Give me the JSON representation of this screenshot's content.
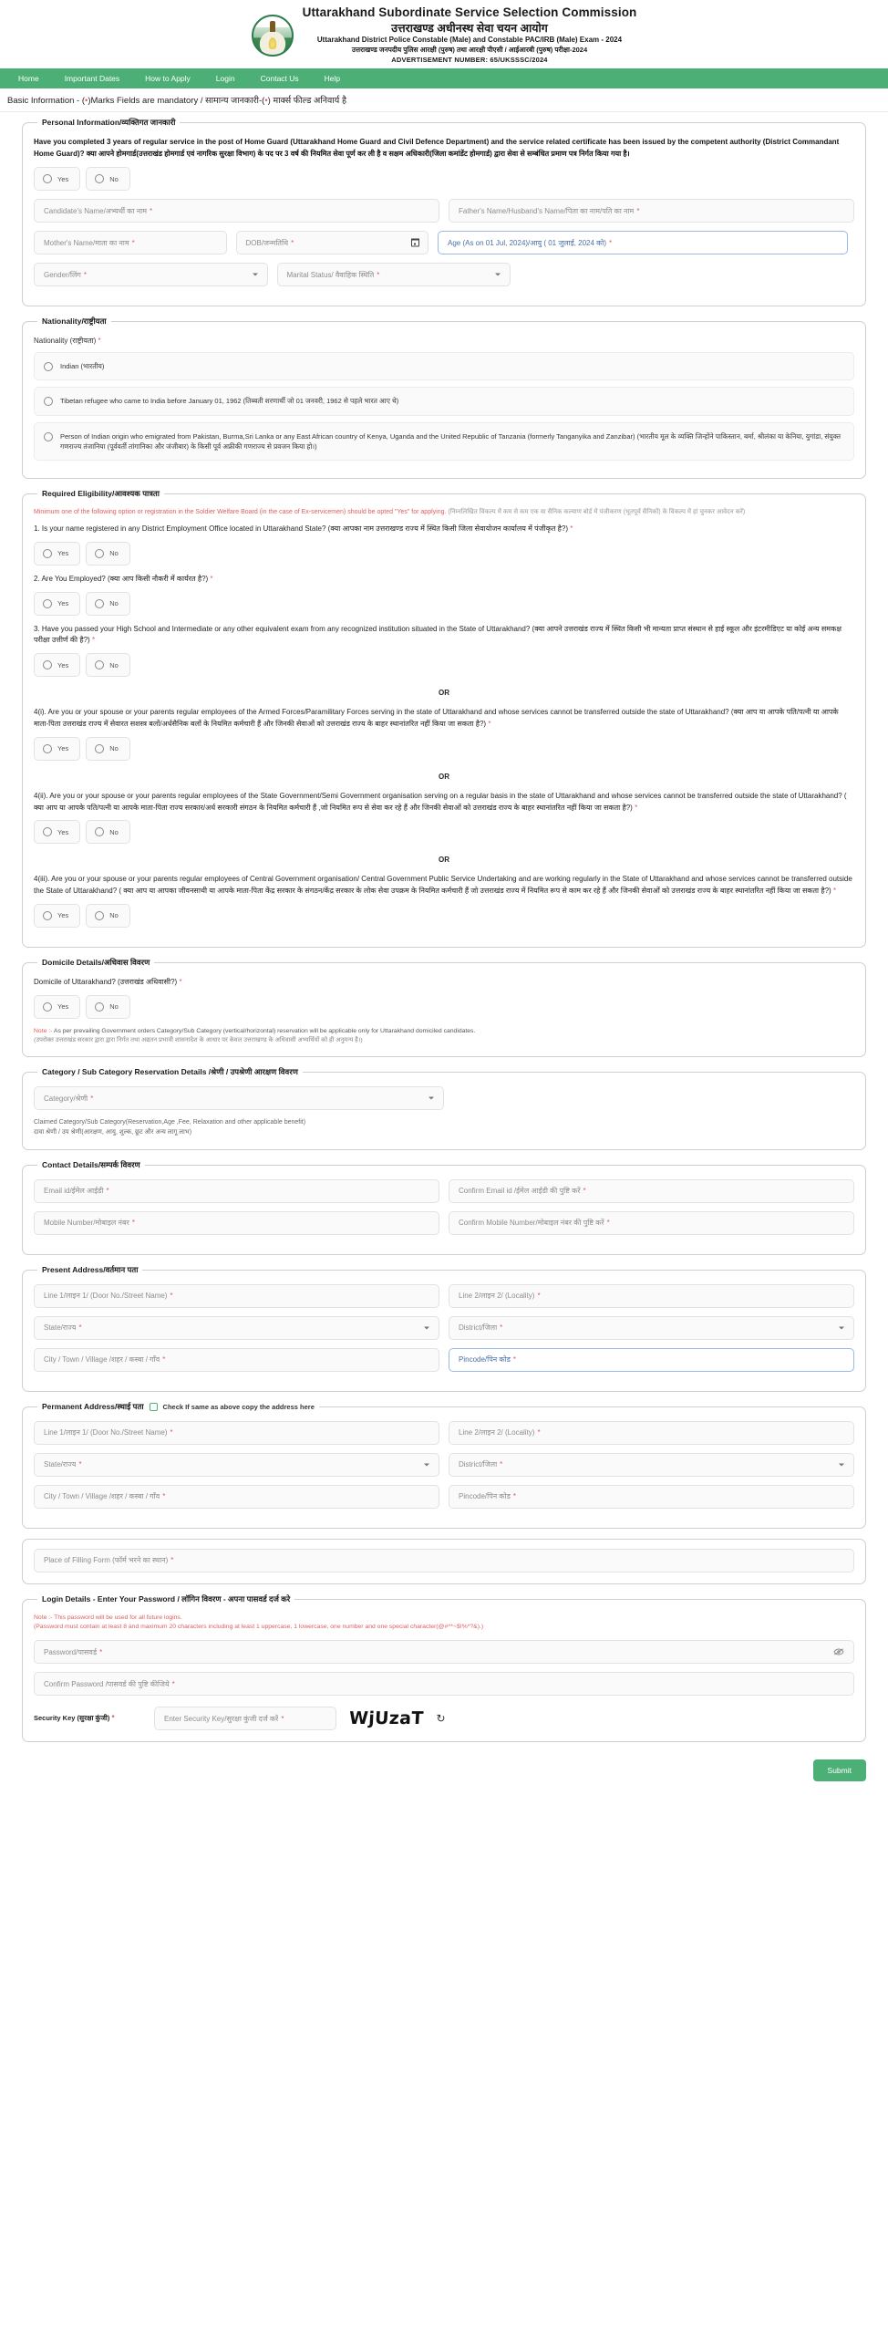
{
  "header": {
    "org_en": "Uttarakhand Subordinate Service Selection Commission",
    "org_hi": "उत्तराखण्ड अधीनस्थ सेवा चयन आयोग",
    "exam_en": "Uttarakhand District Police Constable (Male) and Constable PAC/IRB (Male) Exam - 2024",
    "exam_hi": "उत्तराखण्ड जनपदीय पुलिस आरक्षी (पुरुष) तथा आरक्षी पीएसी / आईआरबी (पुरुष) परीक्षा-2024",
    "advertisement": "ADVERTISEMENT NUMBER: 65/UKSSSC/2024",
    "emblem_alt": "uksssc-emblem"
  },
  "nav": {
    "items": [
      {
        "label": "Home"
      },
      {
        "label": "Important Dates"
      },
      {
        "label": "How to Apply"
      },
      {
        "label": "Login"
      },
      {
        "label": "Contact Us"
      },
      {
        "label": "Help"
      }
    ],
    "bg_color": "#4CAF76"
  },
  "page_title": {
    "prefix": "Basic Information - (",
    "star": "•",
    "middle": ")Marks Fields are mandatory / सामान्य जानकारी-(",
    "suffix": ") मार्क्स फील्ड अनिवार्य है"
  },
  "personal": {
    "legend": "Personal Information/व्यक्तिगत जानकारी",
    "question": "Have you completed 3 years of regular service in the post of Home Guard (Uttarakhand Home Guard and Civil Defence Department) and the service related certificate has been issued by the competent authority (District Commandant Home Guard)? क्या आपने होमगार्ड(उत्तराखंड होमगार्ड एवं नागरिक सुरक्षा विभाग) के पद पर 3 वर्ष की नियमित सेवा पूर्ण कर ली है व सक्षम अधिकारी(जिला कमांडेंट होमगार्ड) द्वारा सेवा से सम्बंधित प्रमाण पत्र निर्गत किया गया है।",
    "yes": "Yes",
    "no": "No",
    "candidate_name": "Candidate's Name/अभ्यर्थी का नाम",
    "father_name": "Father's Name/Husband's Name/पिता का नाम/पति का नाम",
    "mother_name": "Mother's Name/माता का नाम",
    "dob": "DOB/जन्मतिथि",
    "age": "Age (As on 01 Jul, 2024)/आयु ( 01 जुलाई, 2024 को)",
    "gender": "Gender/लिंग",
    "marital_status": "Marital Status/ वैवाहिक स्थिति"
  },
  "nationality": {
    "legend": "Nationality/राष्ट्रीयता",
    "field_label": "Nationality (राष्ट्रीयता)",
    "options": [
      "Indian (भारतीय)",
      "Tibetan refugee who came to India before January 01, 1962 (तिब्बती शरणार्थी जो 01 जनवरी, 1962 से पहले भारत आए थे)",
      "Person of Indian origin who emigrated from Pakistan, Burma,Sri Lanka or any East African country of Kenya, Uganda and the United Republic of Tanzania (formerly Tanganyika and Zanzibar) (भारतीय मूल के व्यक्ति जिन्होंने पाकिस्तान, बर्मा, श्रीलंका या केनिया, युगांडा, संयुक्त गणराज्य तंजानिया (पूर्ववर्ती तांगानिका और जंजीबार) के किसी पूर्व अफ्रीकी गणराज्य से प्रवजन किया हो।)"
    ]
  },
  "eligibility": {
    "legend": "Required Eligibility/आवश्यक पात्रता",
    "note": "Minimum one of the following option or registration in the Soldier Welfare Board (in the case of Ex-servicemen) should be opted \"Yes\" for applying.",
    "note_hi": "(निम्नलिखित विकल्प में कम से कम एक या सैनिक कल्याण बोर्ड में पंजीकरण (भूतपूर्व सैनिकों) के विकल्प में हां चुनकर आवेदन करें)",
    "yes": "Yes",
    "no": "No",
    "or": "OR",
    "questions": [
      "1. Is your name registered in any District Employment Office located in Uttarakhand State? (क्या आपका नाम उत्तराखण्ड राज्य में स्थित किसी जिला सेवायोजन कार्यालय में पंजीकृत है?)",
      "2. Are You Employed? (क्या आप किसी नौकरी में कार्यरत है?)",
      "3. Have you passed your High School and Intermediate or any other equivalent exam from any recognized institution situated in the State of Uttarakhand? (क्या आपने उत्तराखंड राज्य में स्थित किसी भी मान्यता प्राप्त संस्थान से हाई स्कूल और इंटरमीडिएट या कोई अन्य समकक्ष परीक्षा उत्तीर्ण की है?)",
      "4(i). Are you or your spouse or your parents regular employees of the Armed Forces/Paramilitary Forces serving in the state of Uttarakhand and whose services cannot be transferred outside the state of Uttarakhand? (क्या आप या आपके पति/पत्नी या आपके माता-पिता उत्तराखंड राज्य में सेवारत सशस्त्र बलों/अर्धसैनिक बलों के नियमित कर्मचारी हैं और जिनकी सेवाओं को उत्तराखंड राज्य के बाहर स्थानांतरित नहीं किया जा सकता है?)",
      "4(ii). Are you or your spouse or your parents regular employees of the State Government/Semi Government organisation serving on a regular basis in the state of Uttarakhand and whose services cannot be transferred outside the state of Uttarakhand? ( क्या आप या आपके पति/पत्नी या आपके माता-पिता राज्य सरकार/अर्ध सरकारी संगठन के नियमित कर्मचारी हैं ,जो नियमित रूप से सेवा कर रहे हैं और जिनकी सेवाओं को उत्तराखंड राज्य के बाहर स्थानांतरित नहीं किया जा सकता है?)",
      "4(iii). Are you or your spouse or your parents regular employees of Central Government organisation/ Central Government Public Service Undertaking and are working regularly in the State of Uttarakhand and whose services cannot be transferred outside the State of Uttarakhand? ( क्या आप या आपका जीवनसाथी या आपके माता-पिता केंद्र सरकार के संगठन/केंद्र सरकार के लोक सेवा उपक्रम के नियमित कर्मचारी हैं जो उत्तराखंड राज्य में नियमित रूप से काम कर रहे हैं और जिनकी सेवाओं को उत्तराखंड राज्य के बाहर स्थानांतरित नहीं किया जा सकता है?)"
    ]
  },
  "domicile": {
    "legend": "Domicile Details/अधिवास विवरण",
    "question": "Domicile of Uttarakhand? (उत्तराखंड अधिवासी?)",
    "yes": "Yes",
    "no": "No",
    "note_label": "Note :-",
    "note": "As per prevailing Government orders Category/Sub Category (vertical/horizontal) reservation will be applicable only for Uttarakhand domiciled candidates.",
    "note_hi": "(उपरोक्त उत्तराखंड सरकार द्वारा द्वारा निर्गत तथा अद्यतन प्रभावी शासनादेश के आधार पर केवल उत्तराखण्ड के अधिवासी अभ्यर्थियों को ही अनुमन्य है।)"
  },
  "category": {
    "legend": "Category / Sub Category Reservation Details /श्रेणी / उपश्रेणी आरक्षण विवरण",
    "select_placeholder": "Category/श्रेणी",
    "helper_line1": "Claimed Category/Sub Category(Reservation,Age ,Fee, Relaxation and other applicable benefit)",
    "helper_line2": "दावा श्रेणी / उप श्रेणी(आरक्षण, आयु, शुल्क, छूट और अन्य लागू लाभ)"
  },
  "contact": {
    "legend": "Contact Details/सम्पर्क विवरण",
    "email": "Email id/ईमेल आईडी",
    "confirm_email": "Confirm Email id /ईमेल आईडी की पुष्टि करें",
    "mobile": "Mobile Number/मोबाइल नंबर",
    "confirm_mobile": "Confirm Mobile Number/मोबाइल नंबर की पुष्टि करें"
  },
  "present_address": {
    "legend": "Present Address/वर्तमान पता",
    "line1": "Line 1/लाइन 1/ (Door No./Street Name)",
    "line2": "Line 2/लाइन 2/ (Locality)",
    "state": "State/राज्य",
    "district": "District/जिला",
    "city": "City / Town / Village /शहर / कस्बा / गाँव",
    "pincode": "Pincode/पिन कोड"
  },
  "permanent_address": {
    "legend": "Permanent Address/स्थाई पता",
    "same_checkbox": "Check If same as above copy the address here",
    "line1": "Line 1/लाइन 1/ (Door No./Street Name)",
    "line2": "Line 2/लाइन 2/ (Locality)",
    "state": "State/राज्य",
    "district": "District/जिला",
    "city": "City / Town / Village /शहर / कस्बा / गाँव",
    "pincode": "Pincode/पिन कोड"
  },
  "filling_place": {
    "label": "Place of Filling Form (फॉर्म भरने का स्थान)"
  },
  "login_details": {
    "legend": "Login Details - Enter Your Password / लॉगिन विवरण - अपना पासवर्ड दर्ज करे",
    "note_label": "Note :-",
    "note": "This password will be used for all future logins.",
    "note_rule": "(Password must contain at least 8 and maximum 20 characters including at least 1 uppercase, 1 lowercase, one number and one special character(@#^*~$!%*?&).)",
    "password": "Password/पासवर्ड",
    "confirm_password": "Confirm Password /पासवर्ड की पुष्टि कीजिये",
    "security_key_label": "Security Key (सुरक्षा कुंजी)",
    "security_key_placeholder": "Enter Security Key/सुरक्षा कुंजी दर्ज करें",
    "captcha_text": "WjUzaT",
    "refresh_icon": "refresh-icon"
  },
  "footer": {
    "submit_label": "Submit",
    "submit_color": "#4CAF76"
  }
}
